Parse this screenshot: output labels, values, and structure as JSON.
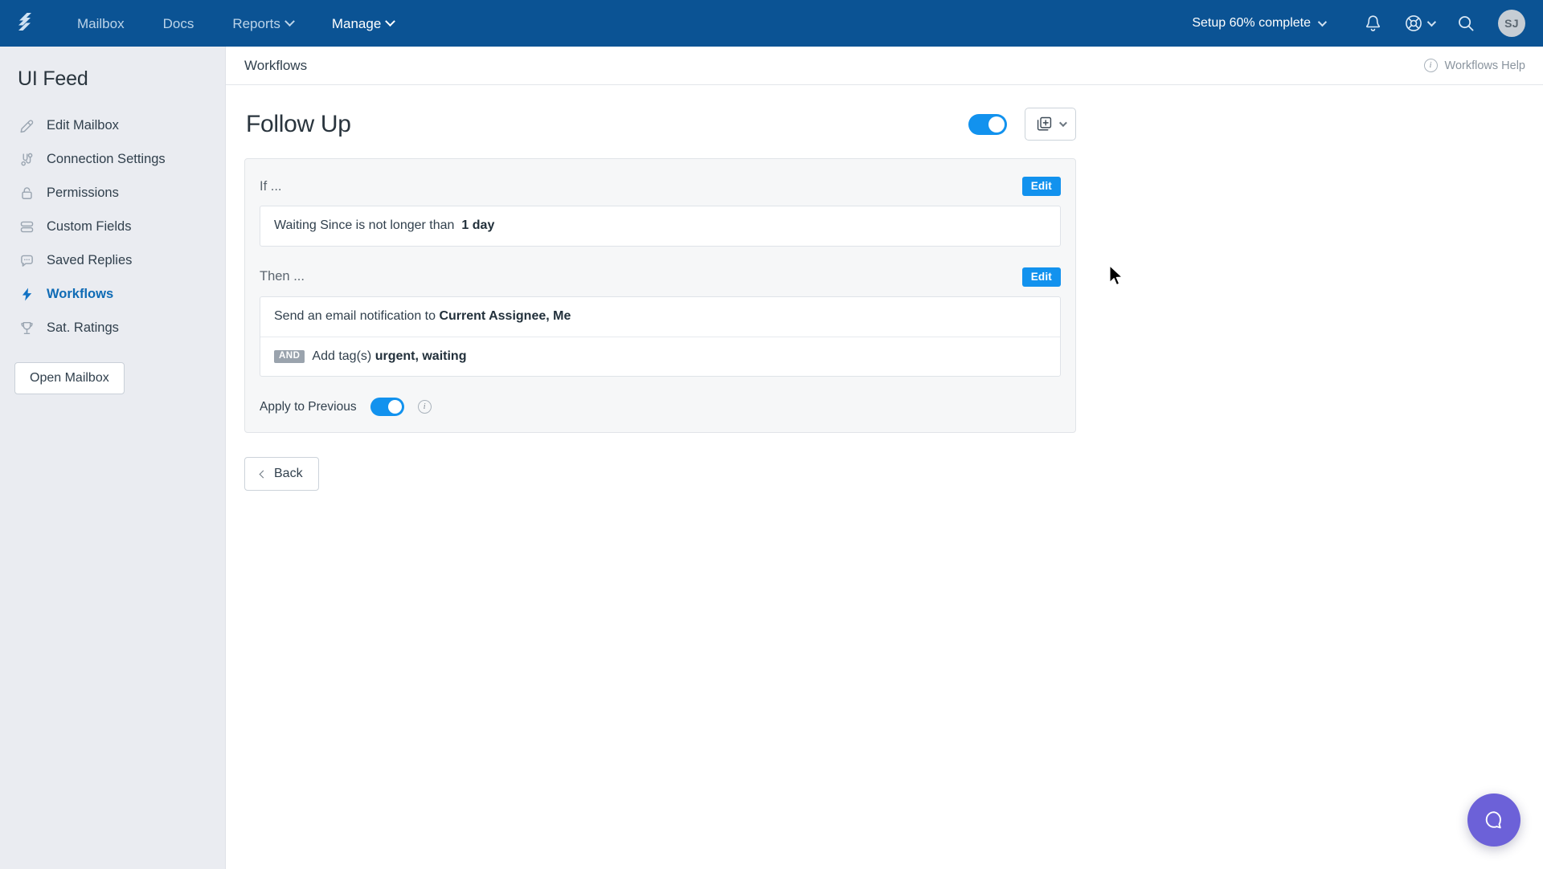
{
  "topnav": {
    "logo_icon": "helpscout-logo-icon",
    "links": [
      {
        "label": "Mailbox",
        "has_caret": false,
        "active": false
      },
      {
        "label": "Docs",
        "has_caret": false,
        "active": false
      },
      {
        "label": "Reports",
        "has_caret": true,
        "active": false
      },
      {
        "label": "Manage",
        "has_caret": true,
        "active": true
      }
    ],
    "setup_status": "Setup 60% complete",
    "icons": {
      "notifications": "bell-icon",
      "support": "lifesaver-icon",
      "search": "search-icon"
    },
    "avatar_initials": "SJ",
    "background_color": "#0b5394"
  },
  "sidebar": {
    "title": "UI Feed",
    "items": [
      {
        "label": "Edit Mailbox",
        "icon": "pencil-icon",
        "active": false
      },
      {
        "label": "Connection Settings",
        "icon": "connection-icon",
        "active": false
      },
      {
        "label": "Permissions",
        "icon": "lock-icon",
        "active": false
      },
      {
        "label": "Custom Fields",
        "icon": "fields-icon",
        "active": false
      },
      {
        "label": "Saved Replies",
        "icon": "chat-bubble-icon",
        "active": false
      },
      {
        "label": "Workflows",
        "icon": "lightning-bolt-icon",
        "active": true
      },
      {
        "label": "Sat. Ratings",
        "icon": "trophy-icon",
        "active": false
      }
    ],
    "open_mailbox_label": "Open Mailbox",
    "active_color": "#0f6bb5"
  },
  "main": {
    "header_title": "Workflows",
    "help_link_label": "Workflows Help",
    "help_link_icon": "info-circle-icon"
  },
  "workflow": {
    "name": "Follow Up",
    "enabled": true,
    "enabled_toggle_color": "#1292ee",
    "duplicate_button_icon": "duplicate-add-icon",
    "if_label": "If ...",
    "if_edit_label": "Edit",
    "conditions": [
      {
        "prefix": "",
        "text": "Waiting Since is not longer than ",
        "bold": "1 day",
        "suffix": ""
      }
    ],
    "then_label": "Then ...",
    "then_edit_label": "Edit",
    "actions": [
      {
        "badge": "",
        "text": "Send an email notification to ",
        "bold": "Current Assignee, Me",
        "suffix": ""
      },
      {
        "badge": "AND",
        "text": "Add tag(s) ",
        "bold": "urgent, waiting",
        "suffix": ""
      }
    ],
    "apply_to_previous_label": "Apply to Previous",
    "apply_to_previous_enabled": true,
    "apply_to_previous_info_icon": "info-circle-icon",
    "back_label": "Back"
  },
  "beacon": {
    "icon": "chat-bubble-icon",
    "color": "#6c61d8"
  }
}
